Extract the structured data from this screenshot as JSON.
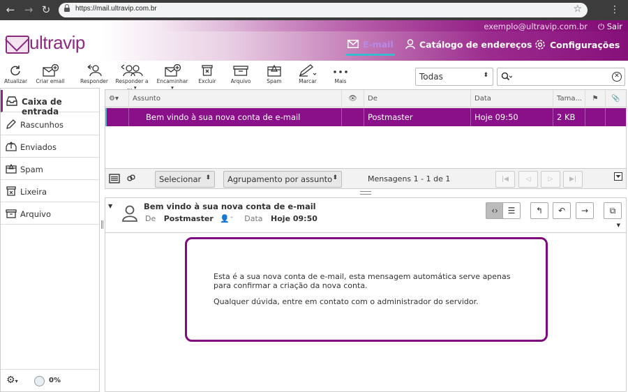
{
  "browser": {
    "url": "https://mail.ultravip.com.br"
  },
  "header": {
    "logo_text": "ultravip",
    "user_email": "exemplo@ultravip.com.br",
    "logout_label": "Sair",
    "nav": [
      {
        "label": "E-mail",
        "icon": "envelope-icon",
        "active": true
      },
      {
        "label": "Catálogo de endereços",
        "icon": "person-icon",
        "active": false
      },
      {
        "label": "Configurações",
        "icon": "gear-icon",
        "active": false
      }
    ]
  },
  "toolbar": {
    "buttons": [
      {
        "label": "Atualizar",
        "icon": "refresh-icon"
      },
      {
        "label": "Criar email",
        "icon": "compose-icon"
      },
      {
        "label": "Responder",
        "icon": "reply-icon"
      },
      {
        "label": "Responder a ...",
        "icon": "reply-all-icon"
      },
      {
        "label": "Encaminhar",
        "icon": "forward-icon"
      },
      {
        "label": "Excluir",
        "icon": "delete-icon"
      },
      {
        "label": "Arquivo",
        "icon": "archive-icon"
      },
      {
        "label": "Spam",
        "icon": "spam-icon"
      },
      {
        "label": "Marcar",
        "icon": "mark-icon"
      },
      {
        "label": "Mais",
        "icon": "more-icon"
      }
    ],
    "filter_value": "Todas",
    "search_value": ""
  },
  "sidebar": {
    "folders": [
      {
        "label": "Caixa de entrada",
        "icon": "inbox-icon",
        "selected": true
      },
      {
        "label": "Rascunhos",
        "icon": "pencil-icon",
        "selected": false
      },
      {
        "label": "Enviados",
        "icon": "sent-icon",
        "selected": false
      },
      {
        "label": "Spam",
        "icon": "spam-folder-icon",
        "selected": false
      },
      {
        "label": "Lixeira",
        "icon": "trash-icon",
        "selected": false
      },
      {
        "label": "Arquivo",
        "icon": "archive-folder-icon",
        "selected": false
      }
    ],
    "quota": "0%"
  },
  "message_list": {
    "columns": [
      "Assunto",
      "De",
      "Data",
      "Tama..."
    ],
    "rows": [
      {
        "subject": "Bem vindo à sua nova conta de e-mail",
        "from": "Postmaster",
        "date": "Hoje 09:50",
        "size": "2 KB"
      }
    ],
    "footer": {
      "select_label": "Selecionar",
      "grouping_label": "Agrupamento por assunto",
      "count_text": "Mensagens 1 - 1 de 1"
    }
  },
  "preview": {
    "subject": "Bem vindo à sua nova conta de e-mail",
    "from_label": "De",
    "from_value": "Postmaster",
    "date_label": "Data",
    "date_value": "Hoje 09:50",
    "body": [
      "Esta é a sua nova conta de e-mail, esta mensagem automática serve apenas para confirmar a criação da nova conta.",
      "Qualquer dúvida, entre em contato com o administrador do servidor."
    ]
  },
  "colors": {
    "accent": "#8a108a",
    "selected_row": "#8a108a",
    "active_tab_underline": "#3ab9cf"
  }
}
